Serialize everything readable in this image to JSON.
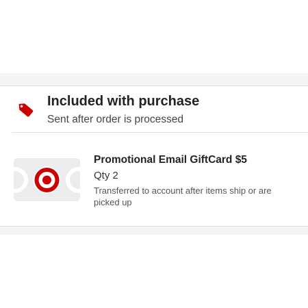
{
  "included_section": {
    "icon": "price-tag-icon",
    "heading": "Included with purchase",
    "subheading": "Sent after order is processed"
  },
  "item": {
    "image": "target-gift-card-icon",
    "name": "Promotional Email GiftCard $5",
    "quantity_label": "Qty 2",
    "note": "Transferred to account after items ship or are picked up"
  },
  "colors": {
    "accent_red": "#cc0000",
    "card_gray": "#ececec",
    "band_gray": "#f4f4f4"
  }
}
